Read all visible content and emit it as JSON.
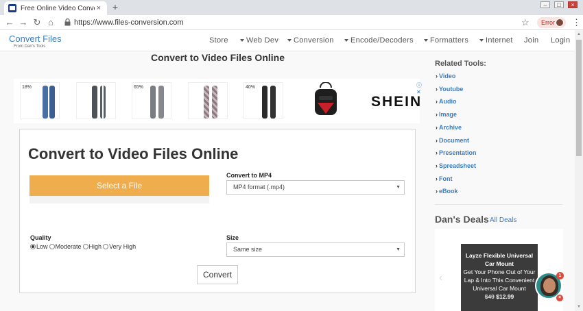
{
  "browser": {
    "tab_title": "Free Online Video Converter - Fi",
    "tab_close": "×",
    "new_tab": "+",
    "url": "https://www.files-conversion.com",
    "error_label": "Error"
  },
  "header": {
    "logo": "Convert Files",
    "logo_sub": "From Dan's Tools",
    "nav": {
      "store": "Store",
      "web_dev": "Web Dev",
      "conversion": "Conversion",
      "encode": "Encode/Decoders",
      "formatters": "Formatters",
      "internet": "Internet",
      "join": "Join",
      "login": "Login"
    }
  },
  "main": {
    "page_title": "Convert to Video Files Online",
    "ads": {
      "discounts": [
        "18%",
        "65%",
        "40%"
      ],
      "brand": "SHEIN"
    },
    "converter": {
      "title": "Convert to Video Files Online",
      "select_button": "Select a File",
      "convert_to_label": "Convert to MP4",
      "format_value": "MP4 format (.mp4)",
      "quality_label": "Quality",
      "quality_options": [
        "Low",
        "Moderate",
        "High",
        "Very High"
      ],
      "quality_selected": "Low",
      "size_label": "Size",
      "size_value": "Same size",
      "convert_button": "Convert"
    }
  },
  "sidebar": {
    "heading": "Related Tools:",
    "links": [
      "Video",
      "Youtube",
      "Audio",
      "Image",
      "Archive",
      "Document",
      "Presentation",
      "Spreadsheet",
      "Font",
      "eBook"
    ],
    "deals_title": "Dan's Deals",
    "deals_link": "All Deals",
    "deal": {
      "name": "Layze Flexible Universal Car Mount",
      "description": "Get Your Phone Out of Your Lap & Into This Convenient Universal Car Mount",
      "old_price": "$49",
      "price": "$12.99"
    },
    "chat_badge": "1",
    "chat_close": "×"
  },
  "colors": {
    "accent_blue": "#3a7cc4",
    "select_orange": "#f0ad4e"
  }
}
